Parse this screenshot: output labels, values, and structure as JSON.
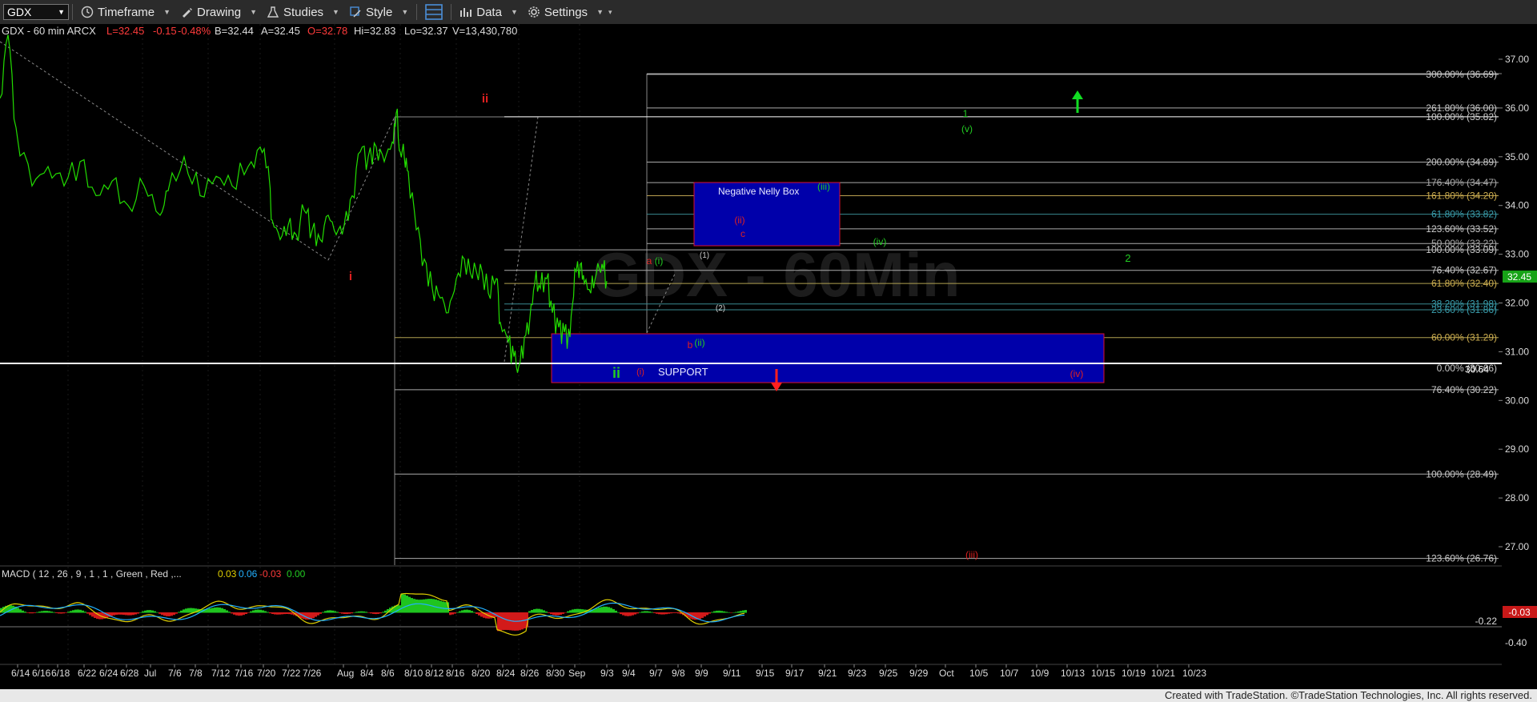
{
  "toolbar": {
    "symbol": "GDX",
    "timeframe_label": "Timeframe",
    "drawing_label": "Drawing",
    "studies_label": "Studies",
    "style_label": "Style",
    "data_label": "Data",
    "settings_label": "Settings"
  },
  "header": {
    "symbol_info": "GDX - 60 min  ARCX",
    "last": "L=32.45",
    "change": "-0.15",
    "change_pct": "-0.48%",
    "bid": "B=32.44",
    "ask": "A=32.45",
    "open": "O=32.78",
    "high": "Hi=32.83",
    "low": "Lo=32.37",
    "volume": "V=13,430,780"
  },
  "watermark": "GDX - 60Min",
  "macd_label": {
    "text": "MACD ( 12 , 26 , 9 , 1 , 1 , Green , Red ,...",
    "v1": "0.03",
    "v2": "0.06",
    "v3": "-0.03",
    "v4": "0.00"
  },
  "footer_text": "Created with TradeStation. ©TradeStation Technologies, Inc. All rights reserved.",
  "colors": {
    "price": "#22dd00",
    "up_arrow": "#11dd22",
    "down_arrow": "#ff1f1f",
    "box_fill": "#0000aa",
    "box_border": "#dd1030",
    "last_price_bg": "#17a317",
    "macd_neg_bg": "#c81818"
  },
  "chart_data": {
    "type": "line",
    "ylim": [
      26.0,
      37.6
    ],
    "y_ticks": [
      "37.00",
      "36.00",
      "35.00",
      "34.00",
      "33.00",
      "32.00",
      "31.00",
      "30.00",
      "29.00",
      "28.00",
      "27.00"
    ],
    "x_labels": [
      "6/14",
      "6/16",
      "6/18",
      "6/22",
      "6/24",
      "6/28",
      "Jul",
      "7/6",
      "7/8",
      "7/12",
      "7/16",
      "7/20",
      "7/22",
      "7/26",
      "Aug",
      "8/4",
      "8/6",
      "8/10",
      "8/12",
      "8/16",
      "8/20",
      "8/24",
      "8/26",
      "8/30",
      "Sep",
      "9/3",
      "9/4",
      "9/7",
      "9/8",
      "9/9",
      "9/11",
      "9/15",
      "9/17",
      "9/21",
      "9/23",
      "9/25",
      "9/29",
      "Oct",
      "10/5",
      "10/7",
      "10/9",
      "10/13",
      "10/15",
      "10/19",
      "10/21",
      "10/23"
    ],
    "last_price": "32.45",
    "price_series": [
      [
        0,
        36.2
      ],
      [
        10,
        37.5
      ],
      [
        20,
        35.6
      ],
      [
        40,
        34.4
      ],
      [
        60,
        34.8
      ],
      [
        80,
        34.4
      ],
      [
        100,
        34.9
      ],
      [
        120,
        34.2
      ],
      [
        140,
        34.5
      ],
      [
        160,
        34.0
      ],
      [
        180,
        34.4
      ],
      [
        200,
        33.8
      ],
      [
        210,
        34.3
      ],
      [
        230,
        35.0
      ],
      [
        250,
        34.2
      ],
      [
        270,
        34.6
      ],
      [
        290,
        34.4
      ],
      [
        310,
        34.8
      ],
      [
        325,
        35.2
      ],
      [
        335,
        34.8
      ],
      [
        340,
        33.7
      ],
      [
        350,
        33.3
      ],
      [
        360,
        33.6
      ],
      [
        370,
        33.4
      ],
      [
        380,
        33.9
      ],
      [
        390,
        33.5
      ],
      [
        400,
        33.3
      ],
      [
        410,
        33.8
      ],
      [
        420,
        33.4
      ],
      [
        430,
        33.6
      ],
      [
        440,
        34.2
      ],
      [
        450,
        35.1
      ],
      [
        460,
        35.0
      ],
      [
        470,
        35.2
      ],
      [
        480,
        34.9
      ],
      [
        490,
        35.3
      ],
      [
        495,
        35.9
      ],
      [
        500,
        35.1
      ],
      [
        505,
        35.0
      ],
      [
        510,
        34.7
      ],
      [
        520,
        33.5
      ],
      [
        530,
        32.9
      ],
      [
        540,
        32.3
      ],
      [
        550,
        32.1
      ],
      [
        560,
        31.8
      ],
      [
        570,
        32.5
      ],
      [
        580,
        32.9
      ],
      [
        590,
        32.5
      ],
      [
        600,
        32.8
      ],
      [
        610,
        32.2
      ],
      [
        620,
        32.5
      ],
      [
        625,
        31.6
      ],
      [
        635,
        31.2
      ],
      [
        642,
        30.9
      ],
      [
        648,
        30.7
      ],
      [
        655,
        31.3
      ],
      [
        662,
        31.7
      ],
      [
        668,
        32.4
      ],
      [
        675,
        32.3
      ],
      [
        683,
        32.5
      ],
      [
        690,
        31.8
      ],
      [
        698,
        31.5
      ],
      [
        705,
        31.4
      ],
      [
        712,
        31.3
      ],
      [
        718,
        32.7
      ],
      [
        725,
        32.8
      ],
      [
        730,
        32.4
      ],
      [
        738,
        32.2
      ],
      [
        745,
        32.6
      ],
      [
        752,
        32.8
      ],
      [
        758,
        32.45
      ]
    ],
    "fib_levels": [
      {
        "label": "300.00% (36.69)",
        "value": 36.69
      },
      {
        "label": "261.80% (36.00)",
        "value": 36.0
      },
      {
        "label": "100.00% (35.82)",
        "value": 35.82
      },
      {
        "label": "200.00% (34.89)",
        "value": 34.89
      },
      {
        "label": "176.40% (34.47)",
        "value": 34.47
      },
      {
        "label": "161.80% (34.20)",
        "value": 34.2
      },
      {
        "label": "61.80% (33.82)",
        "value": 33.82
      },
      {
        "label": "123.60% (33.52)",
        "value": 33.52
      },
      {
        "label": "50.00% (33.22)",
        "value": 33.22
      },
      {
        "label": "100.00% (33.09)",
        "value": 33.09
      },
      {
        "label": "76.40% (32.67)",
        "value": 32.67
      },
      {
        "label": "61.80% (32.40)",
        "value": 32.4
      },
      {
        "label": "38.20% (31.98)",
        "value": 31.98
      },
      {
        "label": "23.60% (31.86)",
        "value": 31.86
      },
      {
        "label": "60.00% (31.29)",
        "value": 31.29
      },
      {
        "label": "0.00% (30.66)",
        "value": 30.66
      },
      {
        "label": "30.64",
        "value": 30.64
      },
      {
        "label": "76.40% (30.22)",
        "value": 30.22
      },
      {
        "label": "100.00% (28.49)",
        "value": 28.49
      },
      {
        "label": "123.60% (26.76)",
        "value": 26.76
      }
    ],
    "annotations": [
      {
        "text": "ii",
        "color": "#e02020"
      },
      {
        "text": "i",
        "color": "#e02020"
      },
      {
        "text": "ii",
        "color": "#22cc22"
      },
      {
        "text": "(i)",
        "color": "#e02020"
      },
      {
        "text": "(i)",
        "color": "#22cc22"
      },
      {
        "text": "(ii)",
        "color": "#22cc22"
      },
      {
        "text": "(ii)",
        "color": "#e02020"
      },
      {
        "text": "(iii)",
        "color": "#22cc22"
      },
      {
        "text": "(iv)",
        "color": "#22cc22"
      },
      {
        "text": "(v)",
        "color": "#22cc22"
      },
      {
        "text": "1",
        "color": "#22cc22"
      },
      {
        "text": "2",
        "color": "#22cc22"
      },
      {
        "text": "a",
        "color": "#e02020"
      },
      {
        "text": "b",
        "color": "#e02020"
      },
      {
        "text": "c",
        "color": "#e02020"
      },
      {
        "text": "(1)",
        "color": "#cccccc"
      },
      {
        "text": "(2)",
        "color": "#cccccc"
      },
      {
        "text": "(iv)",
        "color": "#e02020"
      },
      {
        "text": "(iii)",
        "color": "#e02020"
      }
    ],
    "boxes": [
      {
        "label": "Negative Nelly Box",
        "top": 34.5,
        "bottom": 33.1
      },
      {
        "label": "SUPPORT",
        "top": 31.3,
        "bottom": 30.25
      }
    ],
    "macd": {
      "y_ticks": [
        "-0.22",
        "-0.40"
      ],
      "current": "-0.03"
    }
  }
}
